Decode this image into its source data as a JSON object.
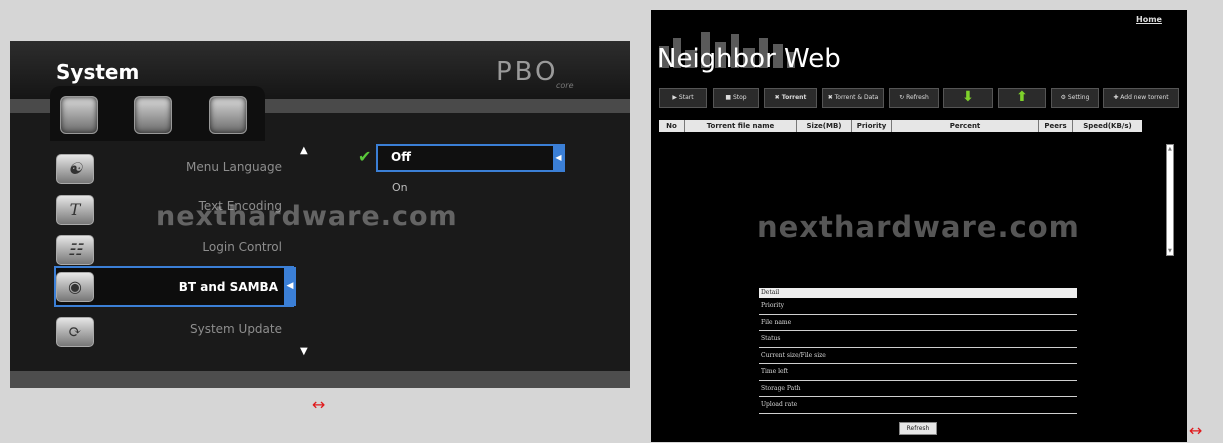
{
  "left_panel": {
    "title": "System",
    "logo_text": "PBO",
    "logo_sub": "core",
    "tab_icons": [
      "video-icon",
      "photo-icon",
      "settings-icon"
    ],
    "menu_items": [
      "Menu Language",
      "Text Encoding",
      "Login Control",
      "BT and SAMBA",
      "System Update"
    ],
    "selected_item": "BT and SAMBA",
    "options": [
      "Off",
      "On"
    ],
    "selected_option": "Off",
    "watermark": "nexthardware.com",
    "accent_color": "#3b7fd6"
  },
  "right_panel": {
    "home_link": "Home",
    "title": "Neighbor Web",
    "toolbar": [
      "▶ Start",
      "■ Stop",
      "✖ Torrent",
      "✖ Torrent & Data",
      "↻ Refresh",
      "⬇",
      "⬆",
      "⚙ Setting",
      "✚ Add new torrent"
    ],
    "table_headers": [
      "No",
      "Torrent file name",
      "Size(MB)",
      "Priority",
      "Percent",
      "Peers",
      "Speed(KB/s)"
    ],
    "detail_header": "Detail",
    "detail_rows": [
      "Priority",
      "File name",
      "Status",
      "Current size/File size",
      "Time left",
      "Storage Path",
      "Upload rate"
    ],
    "refresh_button": "Refresh",
    "watermark": "nexthardware.com"
  },
  "arrows": [
    "↔",
    "↔"
  ]
}
